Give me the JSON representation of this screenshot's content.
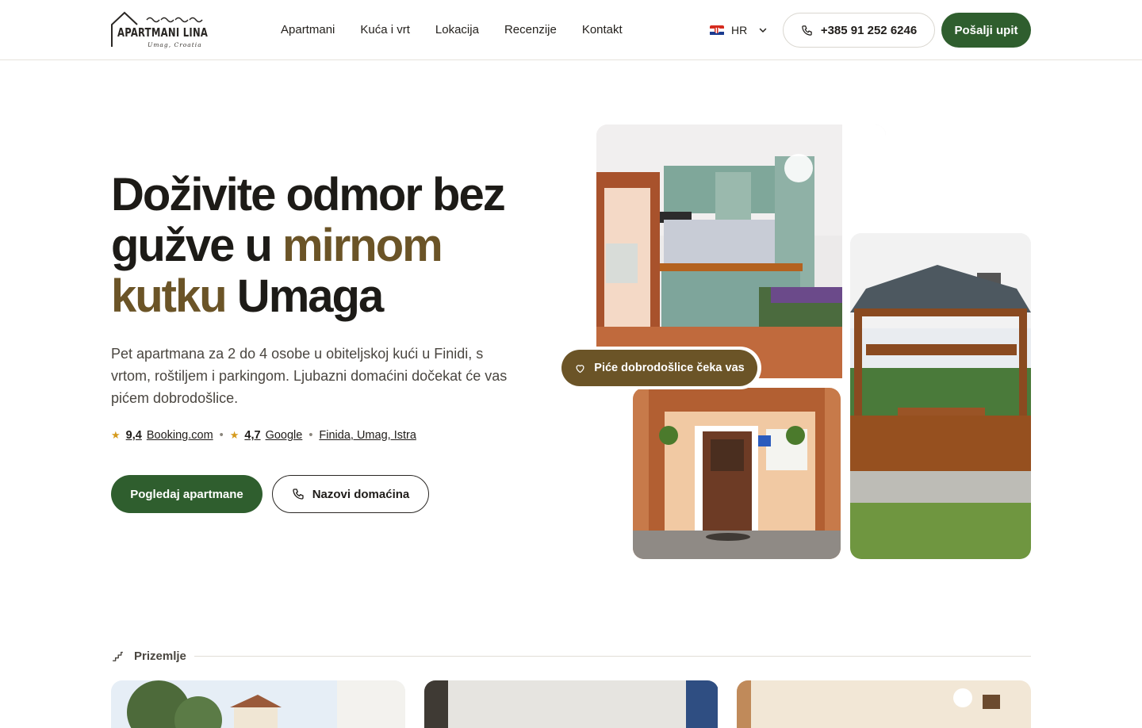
{
  "brand": {
    "name": "APARTMANI LINA",
    "tagline": "Umag, Croatia"
  },
  "nav": [
    {
      "label": "Apartmani"
    },
    {
      "label": "Kuća i vrt"
    },
    {
      "label": "Lokacija"
    },
    {
      "label": "Recenzije"
    },
    {
      "label": "Kontakt"
    }
  ],
  "language": {
    "selected": "HR",
    "flag_icon": "croatia-flag-icon"
  },
  "header": {
    "phone": "+385 91 252 6246",
    "send_label": "Pošalji upit"
  },
  "hero": {
    "title_part1": "Doživite odmor bez gužve u ",
    "title_accent": "mirnom kutku",
    "title_part2": " Umaga",
    "description": "Pet apartmana za 2 do 4 osobe u obiteljskoj kući u Finidi, s vrtom, roštiljem i parkingom. Ljubazni domaćini dočekat će vas pićem dobrodošlice.",
    "ratings": [
      {
        "score": "9,4",
        "source": "Booking.com"
      },
      {
        "score": "4,7",
        "source": "Google"
      }
    ],
    "location": "Finida, Umag, Istra",
    "cta_primary": "Pogledaj apartmane",
    "cta_secondary": "Nazovi domaćina",
    "welcome_badge": "Piće dobrodošlice čeka vas"
  },
  "section": {
    "label": "Prizemlje"
  },
  "colors": {
    "brand_green": "#2f5e2e",
    "accent_brown": "#6b5427",
    "star": "#d59a1c"
  }
}
